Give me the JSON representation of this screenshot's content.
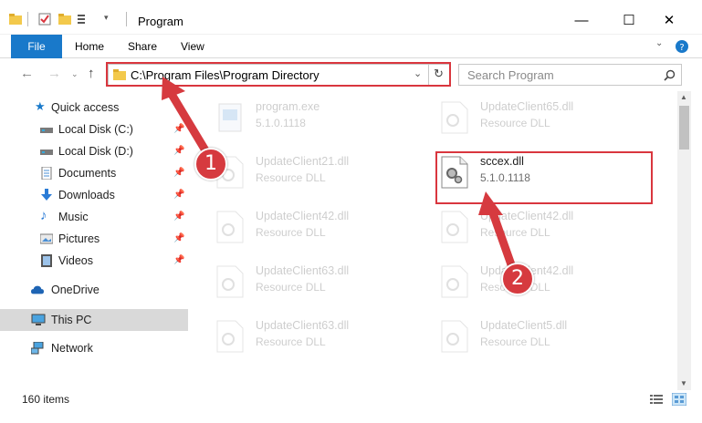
{
  "window": {
    "title": "Program",
    "minimize_glyph": "—",
    "maximize_glyph": "☐",
    "close_glyph": "✕"
  },
  "ribbon": {
    "file": "File",
    "home": "Home",
    "share": "Share",
    "view": "View"
  },
  "address": {
    "path": "C:\\Program Files\\Program Directory",
    "search_placeholder": "Search Program"
  },
  "sidebar": {
    "items": [
      {
        "label": "Quick access",
        "icon": "star-icon"
      },
      {
        "label": "Local Disk (C:)",
        "icon": "drive-icon",
        "pinned": true
      },
      {
        "label": "Local Disk (D:)",
        "icon": "drive-icon",
        "pinned": true
      },
      {
        "label": "Documents",
        "icon": "documents-icon",
        "pinned": true
      },
      {
        "label": "Downloads",
        "icon": "downloads-icon",
        "pinned": true
      },
      {
        "label": "Music",
        "icon": "music-icon",
        "pinned": true
      },
      {
        "label": "Pictures",
        "icon": "pictures-icon",
        "pinned": true
      },
      {
        "label": "Videos",
        "icon": "videos-icon",
        "pinned": true
      },
      {
        "label": "OneDrive",
        "icon": "cloud-icon"
      },
      {
        "label": "This PC",
        "icon": "computer-icon",
        "selected": true
      },
      {
        "label": "Network",
        "icon": "network-icon"
      }
    ]
  },
  "files": [
    {
      "name": "program.exe",
      "sub": "5.1.0.1118"
    },
    {
      "name": "UpdateClient65.dll",
      "sub": "Resource DLL"
    },
    {
      "name": "UpdateClient21.dll",
      "sub": "Resource DLL"
    },
    {
      "name": "sccex.dll",
      "sub": "5.1.0.1118"
    },
    {
      "name": "UpdateClient42.dll",
      "sub": "Resource DLL"
    },
    {
      "name": "UpdateClient42.dll",
      "sub": "Resource DLL"
    },
    {
      "name": "UpdateClient63.dll",
      "sub": "Resource DLL"
    },
    {
      "name": "UpdateClient42.dll",
      "sub": "Resource DLL"
    },
    {
      "name": "UpdateClient63.dll",
      "sub": "Resource DLL"
    },
    {
      "name": "UpdateClient5.dll",
      "sub": "Resource DLL"
    }
  ],
  "status": {
    "item_count": "160 items"
  },
  "annotations": {
    "step1": "1",
    "step2": "2"
  },
  "colors": {
    "accent": "#1979ca",
    "annotation_red": "#d63a3f"
  }
}
